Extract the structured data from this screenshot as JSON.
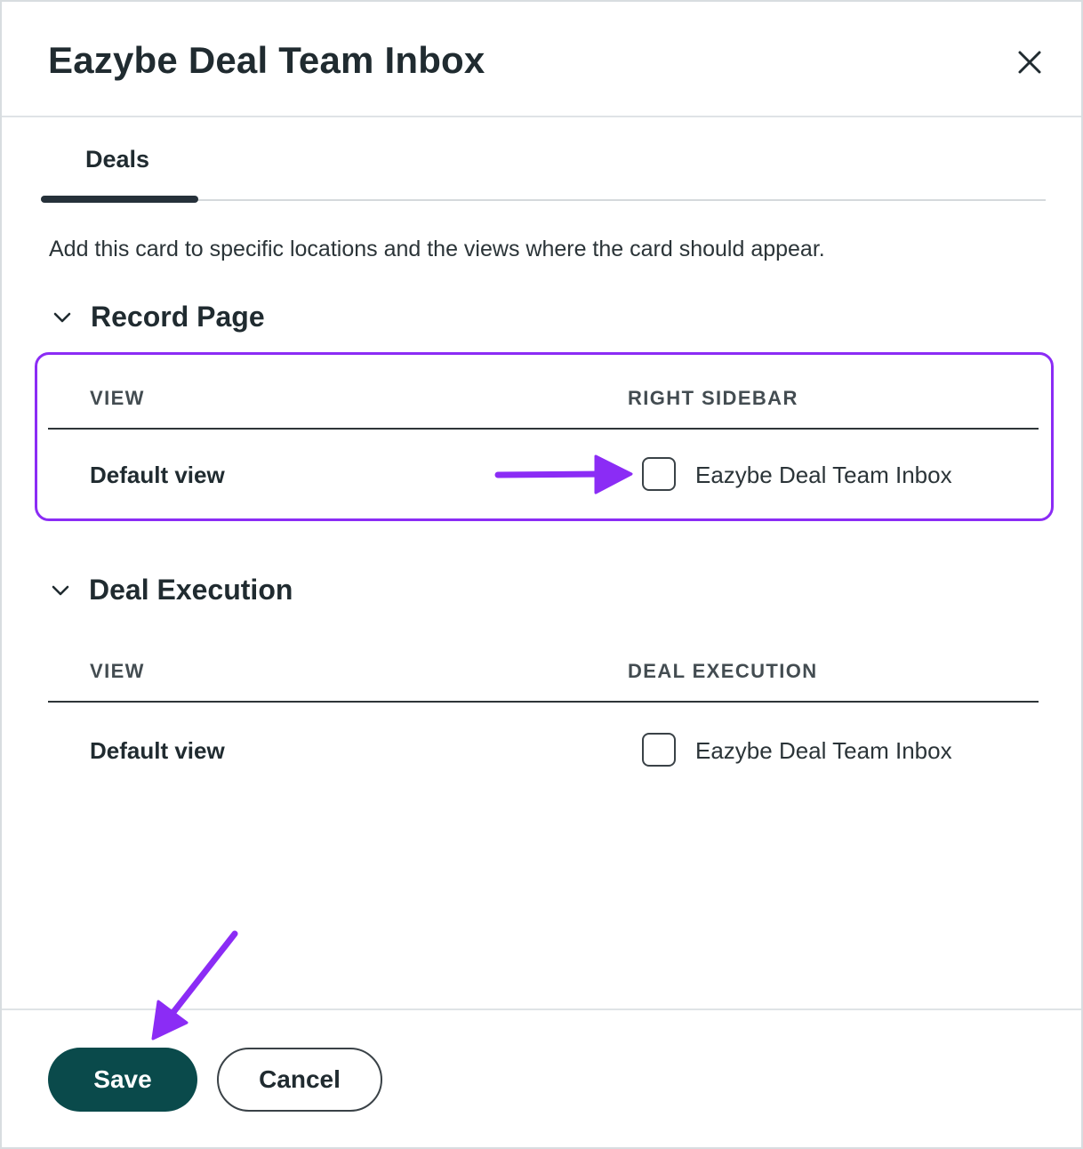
{
  "dialog": {
    "title": "Eazybe Deal Team Inbox",
    "close_icon": "close-icon"
  },
  "tabs": [
    {
      "label": "Deals",
      "active": true
    }
  ],
  "description": "Add this card to specific locations and the views where the card should appear.",
  "sections": [
    {
      "title": "Record Page",
      "expanded": true,
      "column_headers": [
        "VIEW",
        "RIGHT SIDEBAR"
      ],
      "rows": [
        {
          "view": "Default view",
          "option_label": "Eazybe Deal Team Inbox",
          "checked": false
        }
      ]
    },
    {
      "title": "Deal Execution",
      "expanded": true,
      "column_headers": [
        "VIEW",
        "DEAL EXECUTION"
      ],
      "rows": [
        {
          "view": "Default view",
          "option_label": "Eazybe Deal Team Inbox",
          "checked": false
        }
      ]
    }
  ],
  "footer": {
    "save_label": "Save",
    "cancel_label": "Cancel"
  },
  "colors": {
    "accent_annotation": "#8b2cf5",
    "save_button": "#0a4a4b",
    "text_primary": "#202b30"
  },
  "icons": {
    "section_toggle": "chevron-down-icon",
    "annotation": "arrow-icon"
  }
}
